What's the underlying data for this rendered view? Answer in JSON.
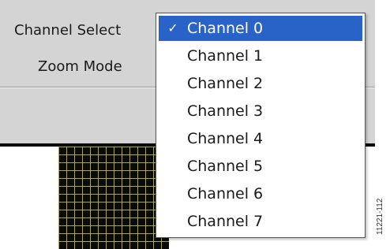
{
  "controls": {
    "channel_select_label": "Channel Select",
    "zoom_mode_label": "Zoom Mode"
  },
  "dropdown": {
    "selected_index": 0,
    "check_glyph": "✓",
    "options": [
      {
        "label": "Channel 0"
      },
      {
        "label": "Channel 1"
      },
      {
        "label": "Channel 2"
      },
      {
        "label": "Channel 3"
      },
      {
        "label": "Channel 4"
      },
      {
        "label": "Channel 5"
      },
      {
        "label": "Channel 6"
      },
      {
        "label": "Channel 7"
      }
    ],
    "selection_color": "#2a63c8"
  },
  "figure_id": "11221-112",
  "icons": {
    "checkmark": "check-icon"
  },
  "colors": {
    "panel_background": "#d4d4d4",
    "plot_background": "#0a0a0a",
    "plot_grid": "#bebe6e"
  }
}
